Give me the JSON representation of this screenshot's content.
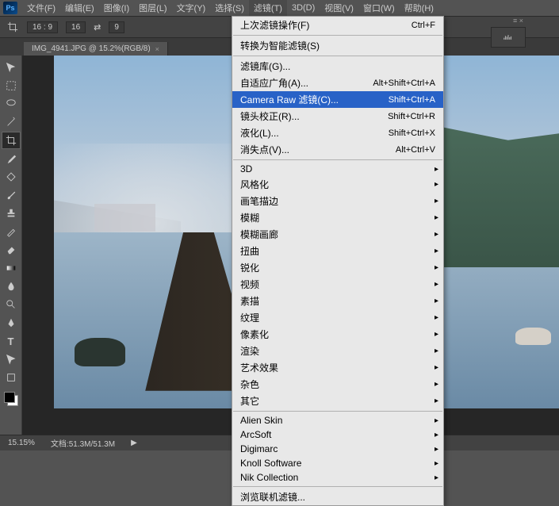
{
  "menubar": {
    "logo": "Ps",
    "items": [
      "文件(F)",
      "编辑(E)",
      "图像(I)",
      "图层(L)",
      "文字(Y)",
      "选择(S)",
      "滤镜(T)",
      "3D(D)",
      "视图(V)",
      "窗口(W)",
      "帮助(H)"
    ]
  },
  "options": {
    "ratio": "16 : 9",
    "val1": "16",
    "swap": "⇄",
    "val2": "9"
  },
  "tab": {
    "title": "IMG_4941.JPG @ 15.2%(RGB/8)",
    "close": "×"
  },
  "dropdown": {
    "items": [
      {
        "label": "上次滤镜操作(F)",
        "shortcut": "Ctrl+F",
        "sep": true
      },
      {
        "label": "转换为智能滤镜(S)",
        "sep": true
      },
      {
        "label": "滤镜库(G)..."
      },
      {
        "label": "自适应广角(A)...",
        "shortcut": "Alt+Shift+Ctrl+A"
      },
      {
        "label": "Camera Raw 滤镜(C)...",
        "shortcut": "Shift+Ctrl+A",
        "highlight": true
      },
      {
        "label": "镜头校正(R)...",
        "shortcut": "Shift+Ctrl+R"
      },
      {
        "label": "液化(L)...",
        "shortcut": "Shift+Ctrl+X"
      },
      {
        "label": "消失点(V)...",
        "shortcut": "Alt+Ctrl+V",
        "sep": true
      },
      {
        "label": "3D",
        "sub": true
      },
      {
        "label": "风格化",
        "sub": true
      },
      {
        "label": "画笔描边",
        "sub": true
      },
      {
        "label": "模糊",
        "sub": true
      },
      {
        "label": "模糊画廊",
        "sub": true
      },
      {
        "label": "扭曲",
        "sub": true
      },
      {
        "label": "锐化",
        "sub": true
      },
      {
        "label": "视频",
        "sub": true
      },
      {
        "label": "素描",
        "sub": true
      },
      {
        "label": "纹理",
        "sub": true
      },
      {
        "label": "像素化",
        "sub": true
      },
      {
        "label": "渲染",
        "sub": true
      },
      {
        "label": "艺术效果",
        "sub": true
      },
      {
        "label": "杂色",
        "sub": true
      },
      {
        "label": "其它",
        "sub": true,
        "sep": true
      },
      {
        "label": "Alien Skin",
        "sub": true
      },
      {
        "label": "ArcSoft",
        "sub": true
      },
      {
        "label": "Digimarc",
        "sub": true
      },
      {
        "label": "Knoll Software",
        "sub": true
      },
      {
        "label": "Nik Collection",
        "sub": true,
        "sep": true
      },
      {
        "label": "浏览联机滤镜..."
      }
    ]
  },
  "status": {
    "zoom": "15.15%",
    "doc": "文档:51.3M/51.3M"
  },
  "panel": {
    "icon": "📊"
  }
}
